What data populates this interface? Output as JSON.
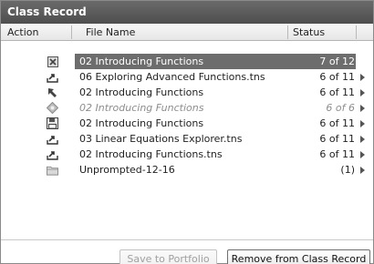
{
  "panel": {
    "title": "Class Record"
  },
  "columns": {
    "action": "Action",
    "file_name": "File Name",
    "status": "Status"
  },
  "rows": [
    {
      "icon": "collected-icon",
      "file": "02 Introducing Functions",
      "status": "7 of 12",
      "selected": true,
      "dim": false,
      "arrow": false
    },
    {
      "icon": "sent-tray-icon",
      "file": "06 Exploring Advanced Functions.tns",
      "status": "6 of 11",
      "selected": false,
      "dim": false,
      "arrow": true
    },
    {
      "icon": "collect-arrow-icon",
      "file": "02 Introducing Functions",
      "status": "6 of 11",
      "selected": false,
      "dim": false,
      "arrow": true
    },
    {
      "icon": "quick-poll-icon",
      "file": "02 Introducing Functions",
      "status": "6 of 6",
      "selected": false,
      "dim": true,
      "arrow": true
    },
    {
      "icon": "save-disk-icon",
      "file": "02 Introducing Functions",
      "status": "6 of 11",
      "selected": false,
      "dim": false,
      "arrow": true
    },
    {
      "icon": "sent-tray-icon",
      "file": "03 Linear Equations Explorer.tns",
      "status": "6 of 11",
      "selected": false,
      "dim": false,
      "arrow": true
    },
    {
      "icon": "sent-tray-icon",
      "file": "02 Introducing Functions.tns",
      "status": "6 of 11",
      "selected": false,
      "dim": false,
      "arrow": true
    },
    {
      "icon": "folder-icon",
      "file": "Unprompted-12-16",
      "status": "(1)",
      "selected": false,
      "dim": false,
      "arrow": true
    }
  ],
  "buttons": {
    "save_to_portfolio": "Save to Portfolio",
    "remove_from_class_record": "Remove from Class Record"
  },
  "colors": {
    "titlebar": "#555555",
    "selection": "#6d6d6d"
  }
}
